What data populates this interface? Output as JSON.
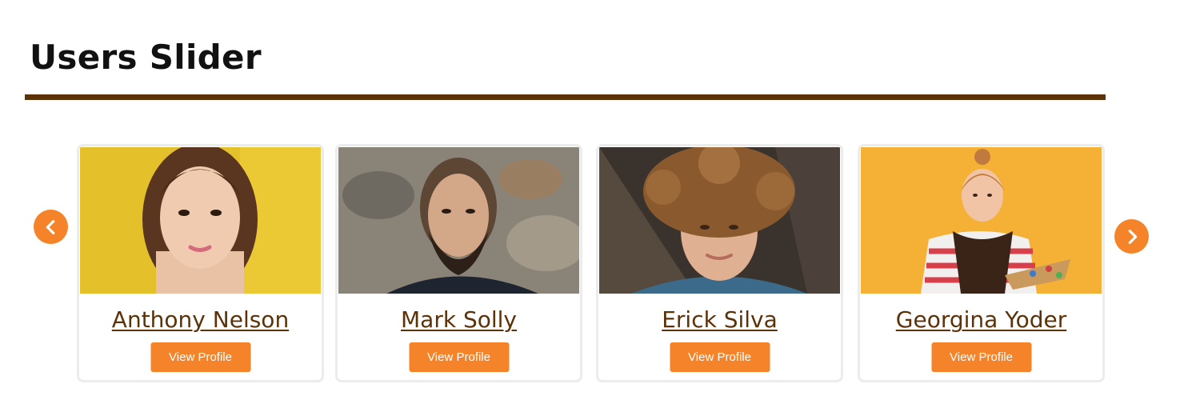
{
  "page": {
    "title": "Users Slider"
  },
  "slider": {
    "prev_icon": "chevron-left-icon",
    "next_icon": "chevron-right-icon",
    "accent_color": "#f5832a",
    "name_color": "#5c3209",
    "users": [
      {
        "name": "Anthony Nelson",
        "button_label": "View Profile"
      },
      {
        "name": "Mark Solly",
        "button_label": "View Profile"
      },
      {
        "name": "Erick Silva",
        "button_label": "View Profile"
      },
      {
        "name": "Georgina Yoder",
        "button_label": "View Profile"
      }
    ]
  }
}
